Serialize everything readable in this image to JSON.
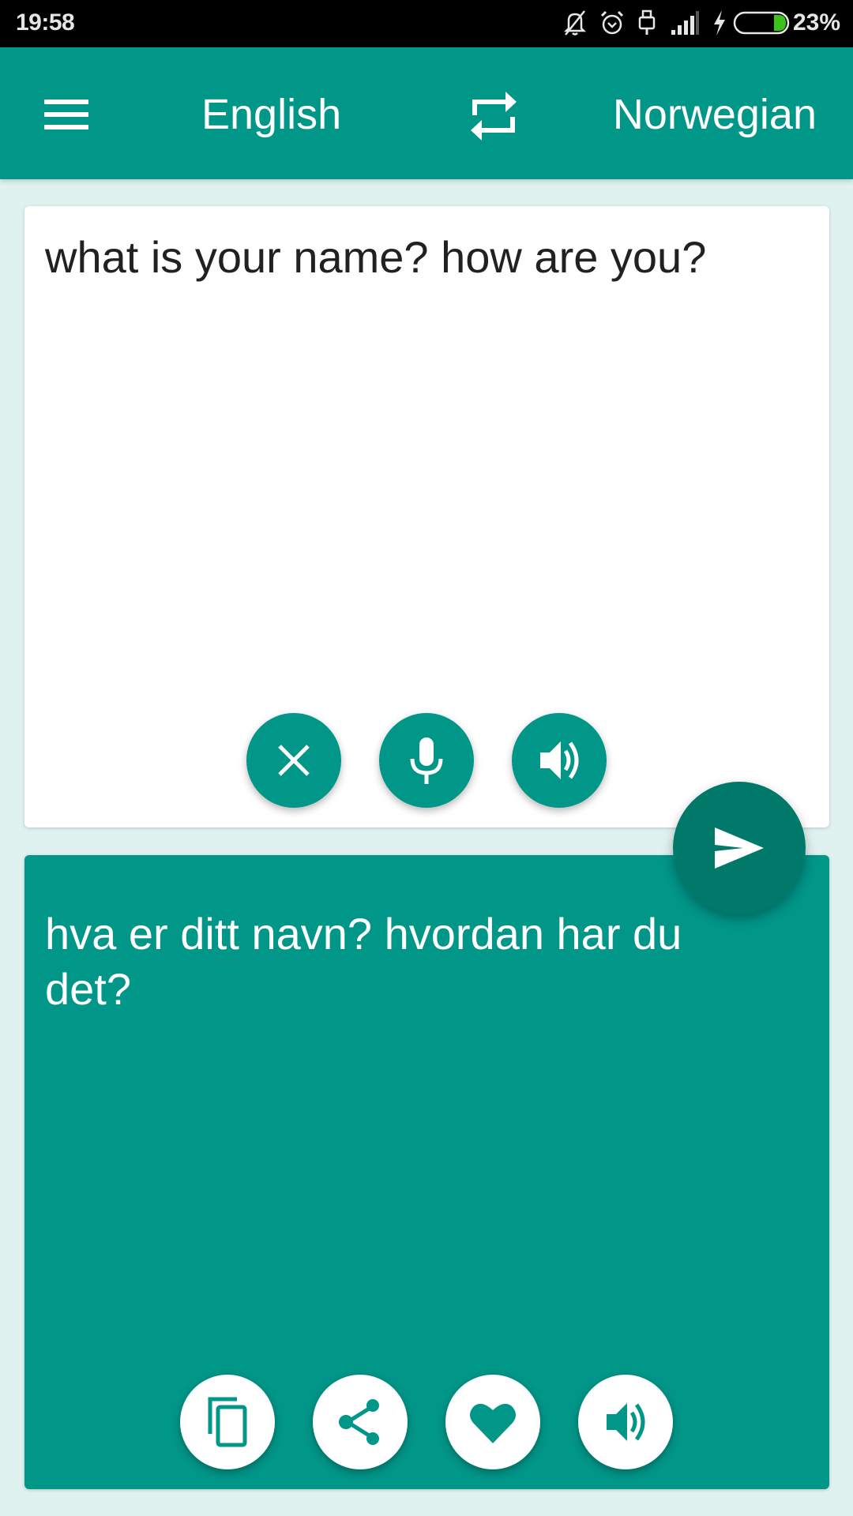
{
  "status_bar": {
    "time": "19:58",
    "battery_percent": "23%",
    "battery_level": 0.23,
    "icons": [
      "notifications-off-icon",
      "alarm-icon",
      "usb-icon",
      "signal-icon",
      "charging-bolt-icon",
      "battery-icon"
    ]
  },
  "app_bar": {
    "menu_icon": "menu-icon",
    "source_language": "English",
    "swap_icon": "swap-icon",
    "target_language": "Norwegian"
  },
  "input_card": {
    "text": "what is your name? how are you?",
    "actions": [
      {
        "name": "clear",
        "icon": "close-icon"
      },
      {
        "name": "voice-input",
        "icon": "microphone-icon"
      },
      {
        "name": "speak",
        "icon": "volume-icon"
      }
    ]
  },
  "translate_button": {
    "icon": "send-icon"
  },
  "output_card": {
    "text": "hva er ditt navn? hvordan har du det?",
    "actions": [
      {
        "name": "copy",
        "icon": "copy-icon"
      },
      {
        "name": "share",
        "icon": "share-icon"
      },
      {
        "name": "favorite",
        "icon": "heart-icon"
      },
      {
        "name": "speak",
        "icon": "volume-icon"
      }
    ]
  },
  "colors": {
    "primary": "#009688",
    "primary_dark": "#00796b",
    "background": "#e0f2f0",
    "battery_fill": "#3cc21d"
  }
}
